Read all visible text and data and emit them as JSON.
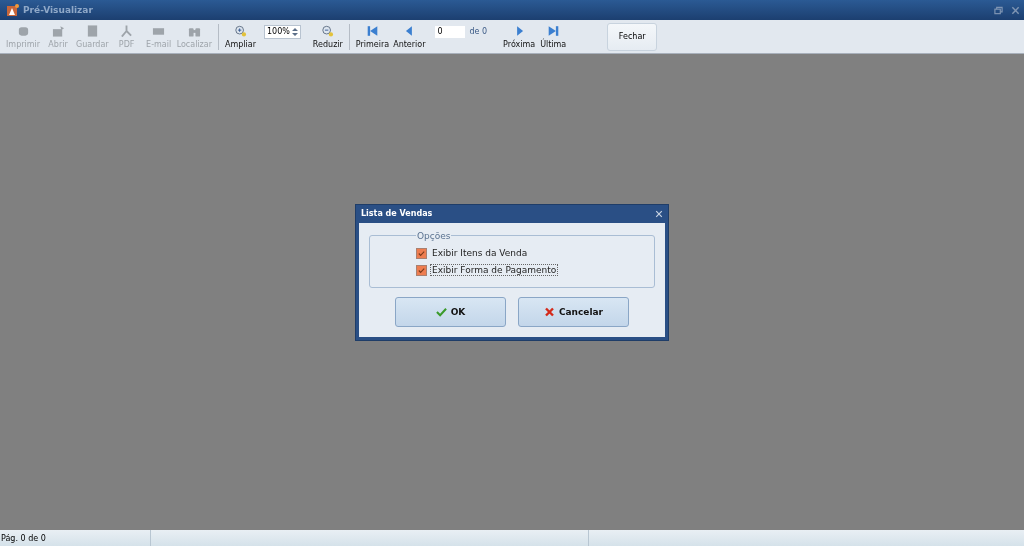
{
  "window": {
    "title": "Pré-Visualizar"
  },
  "toolbar": {
    "file_buttons": [
      {
        "label": "Imprimir",
        "disabled": true
      },
      {
        "label": "Abrir",
        "disabled": true
      },
      {
        "label": "Guardar",
        "disabled": true
      },
      {
        "label": "PDF",
        "disabled": true
      },
      {
        "label": "E-mail",
        "disabled": true
      },
      {
        "label": "Localizar",
        "disabled": true
      }
    ],
    "zoom_in": {
      "label": "Ampliar",
      "disabled": false
    },
    "zoom_value": "100%",
    "zoom_out": {
      "label": "Reduzir",
      "disabled": false
    },
    "first": {
      "label": "Primeira",
      "disabled": false
    },
    "previous": {
      "label": "Anterior",
      "disabled": false
    },
    "page_value": "0",
    "page_total": "de 0",
    "next": {
      "label": "Próxima",
      "disabled": false
    },
    "last": {
      "label": "Última",
      "disabled": false
    },
    "close_button": "Fechar"
  },
  "dialog": {
    "title": "Lista de Vendas",
    "group_label": "Opções",
    "options": [
      {
        "label": "Exibir Itens da Venda",
        "checked": true,
        "focused": false
      },
      {
        "label": "Exibir Forma de Pagamento",
        "checked": true,
        "focused": true
      }
    ],
    "buttons": [
      {
        "kind": "ok",
        "label": "OK"
      },
      {
        "kind": "cancel",
        "label": "Cancelar"
      }
    ]
  },
  "status_bar": {
    "page": "Pág. 0 de 0"
  }
}
